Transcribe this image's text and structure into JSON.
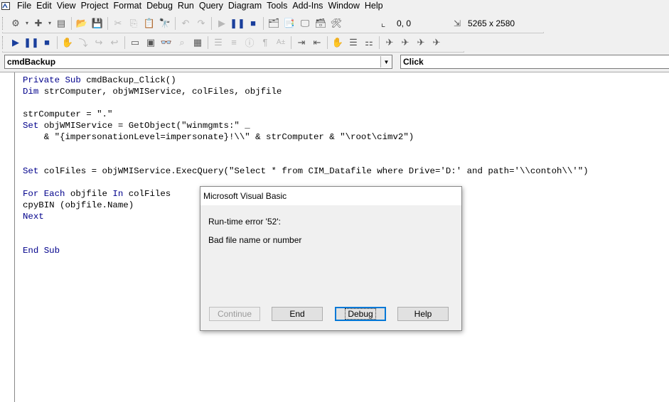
{
  "menu": [
    "File",
    "Edit",
    "View",
    "Project",
    "Format",
    "Debug",
    "Run",
    "Query",
    "Diagram",
    "Tools",
    "Add-Ins",
    "Window",
    "Help"
  ],
  "toolbar": {
    "position_readout": "0, 0",
    "size_readout": "5265 x 2580"
  },
  "object_combo": {
    "value": "cmdBackup"
  },
  "procedure_combo": {
    "value": "Click"
  },
  "code_lines": [
    [
      {
        "t": "Private Sub ",
        "k": true
      },
      {
        "t": "cmdBackup_Click()",
        "k": false
      }
    ],
    [
      {
        "t": "Dim ",
        "k": true
      },
      {
        "t": "strComputer, objWMIService, colFiles, objfile",
        "k": false
      }
    ],
    [],
    [
      {
        "t": "strComputer = \".\"",
        "k": false
      }
    ],
    [
      {
        "t": "Set ",
        "k": true
      },
      {
        "t": "objWMIService = GetObject(\"winmgmts:\" _",
        "k": false
      }
    ],
    [
      {
        "t": "    & \"{impersonationLevel=impersonate}!\\\\\" & strComputer & \"\\root\\cimv2\")",
        "k": false
      }
    ],
    [],
    [],
    [
      {
        "t": "Set ",
        "k": true
      },
      {
        "t": "colFiles = objWMIService.ExecQuery(\"Select * from CIM_Datafile where Drive='D:' and path='\\\\contoh\\\\'\")",
        "k": false
      }
    ],
    [],
    [
      {
        "t": "For Each ",
        "k": true
      },
      {
        "t": "objfile ",
        "k": false
      },
      {
        "t": "In ",
        "k": true
      },
      {
        "t": "colFiles",
        "k": false
      }
    ],
    [
      {
        "t": "cpyBIN (objfile.Name)",
        "k": false
      }
    ],
    [
      {
        "t": "Next",
        "k": true
      }
    ],
    [],
    [],
    [
      {
        "t": "End Sub",
        "k": true
      }
    ]
  ],
  "dialog": {
    "title": "Microsoft Visual Basic",
    "error": "Run-time error '52':",
    "message": "Bad file name or number",
    "buttons": {
      "continue": "Continue",
      "end": "End",
      "debug": "Debug",
      "help": "Help"
    }
  }
}
